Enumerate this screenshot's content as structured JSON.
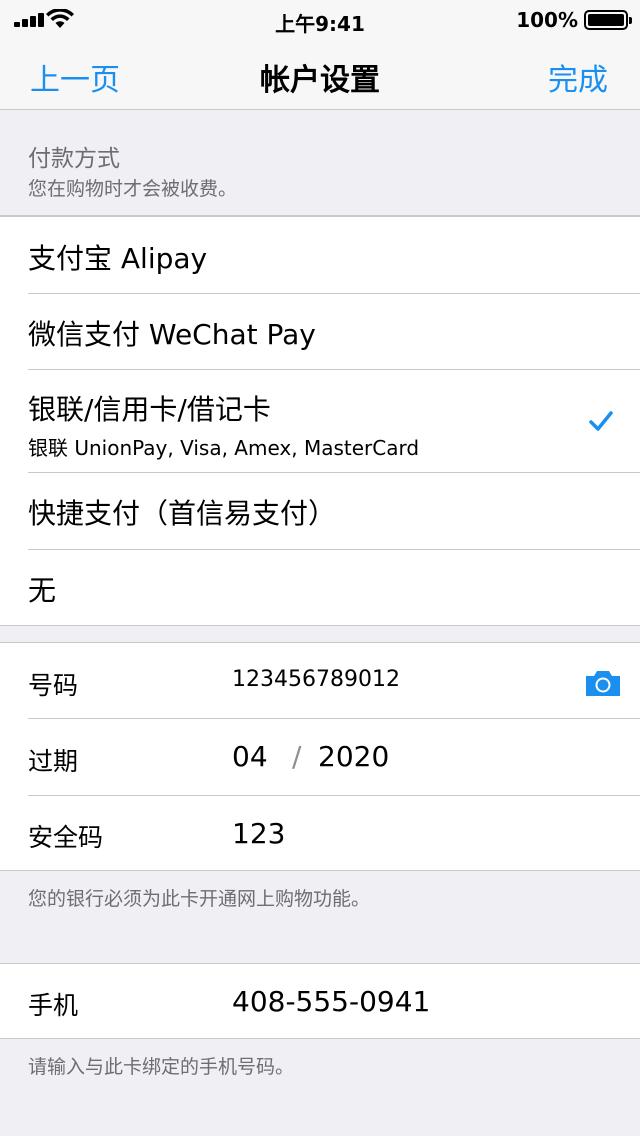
{
  "status_bar": {
    "time": "上午9:41",
    "battery_percent": "100%"
  },
  "nav": {
    "back_label": "上一页",
    "title": "帐户设置",
    "done_label": "完成"
  },
  "payment_section": {
    "title": "付款方式",
    "subtitle": "您在购物时才会被收费。"
  },
  "payment_options": [
    {
      "label": "支付宝 Alipay",
      "selected": false
    },
    {
      "label": "微信支付 WeChat Pay",
      "selected": false
    },
    {
      "label": "银联/信用卡/借记卡",
      "sublabel": "银联 UnionPay, Visa, Amex, MasterCard",
      "selected": true
    },
    {
      "label": "快捷支付（首信易支付）",
      "selected": false
    },
    {
      "label": "无",
      "selected": false
    }
  ],
  "card_fields": {
    "number_label": "号码",
    "number_value": "123456789012",
    "expiry_label": "过期",
    "expiry_month": "04",
    "expiry_separator": "/",
    "expiry_year": "2020",
    "security_label": "安全码",
    "security_value": "123",
    "note": "您的银行必须为此卡开通网上购物功能。"
  },
  "phone_field": {
    "label": "手机",
    "value": "408-555-0941",
    "note": "请输入与此卡绑定的手机号码。"
  },
  "colors": {
    "accent": "#1a8ff0",
    "background": "#efeff4",
    "separator": "#c8c7cc",
    "secondary_text": "#6d6d72"
  }
}
